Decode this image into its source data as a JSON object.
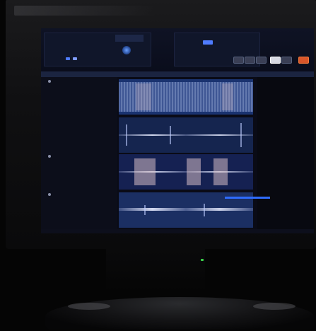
{
  "scene": {
    "description_tag": "monitor-photo",
    "software": {
      "time_display": "",
      "toolbar_text": "",
      "status_text": ""
    }
  },
  "colors": {
    "screen_bg": "#0a0b16",
    "lane_blue": "#1a3370",
    "waveform": "#c8d7ff",
    "region_pink": "#d6bec4",
    "accent_orange": "#d9562a",
    "scroll_blue": "#2f6cff",
    "power_led": "#3bd24a"
  },
  "icons": [
    "dial-icon",
    "play-button-icon",
    "power-led-icon"
  ]
}
